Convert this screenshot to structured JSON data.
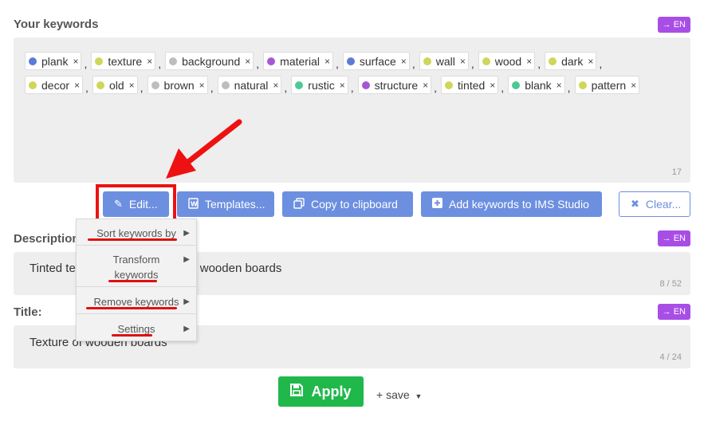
{
  "keywords_section": {
    "title": "Your keywords",
    "lang_label": "→ EN",
    "count": "17",
    "items": [
      {
        "label": "plank",
        "color": "#5b7bd6"
      },
      {
        "label": "texture",
        "color": "#cfd65a"
      },
      {
        "label": "background",
        "color": "#bdbdbd"
      },
      {
        "label": "material",
        "color": "#a558d6"
      },
      {
        "label": "surface",
        "color": "#5b7bd6"
      },
      {
        "label": "wall",
        "color": "#cfd65a"
      },
      {
        "label": "wood",
        "color": "#cfd65a"
      },
      {
        "label": "dark",
        "color": "#cfd65a"
      },
      {
        "label": "decor",
        "color": "#cfd65a"
      },
      {
        "label": "old",
        "color": "#cfd65a"
      },
      {
        "label": "brown",
        "color": "#bdbdbd"
      },
      {
        "label": "natural",
        "color": "#bdbdbd"
      },
      {
        "label": "rustic",
        "color": "#4ec994"
      },
      {
        "label": "structure",
        "color": "#a558d6"
      },
      {
        "label": "tinted",
        "color": "#cfd65a"
      },
      {
        "label": "blank",
        "color": "#4ec994"
      },
      {
        "label": "pattern",
        "color": "#cfd65a"
      }
    ],
    "remove_glyph": "×",
    "separator": ","
  },
  "toolbar": {
    "edit_label": "Edit...",
    "templates_label": "Templates...",
    "copy_label": "Copy to clipboard",
    "add_label": "Add keywords to IMS Studio",
    "clear_label": "Clear..."
  },
  "edit_menu": {
    "items": [
      {
        "label": "Sort keywords by"
      },
      {
        "label": "Transform keywords"
      },
      {
        "label": "Remove keywords"
      },
      {
        "label": "Settings"
      }
    ],
    "arrow_glyph": "▶"
  },
  "description_section": {
    "title": "Description:",
    "lang_label": "→ EN",
    "value": "Tinted texture of an old plank of wooden boards",
    "count": "8 / 52"
  },
  "title_section": {
    "title": "Title:",
    "lang_label": "→ EN",
    "value": "Texture of wooden boards",
    "count": "4 / 24"
  },
  "footer": {
    "apply_label": "Apply",
    "save_label": "+ save"
  },
  "colors": {
    "accent_blue": "#6c8fe0",
    "accent_purple": "#a84ee6",
    "apply_green": "#21b84b",
    "annotation_red": "#ee1111"
  }
}
